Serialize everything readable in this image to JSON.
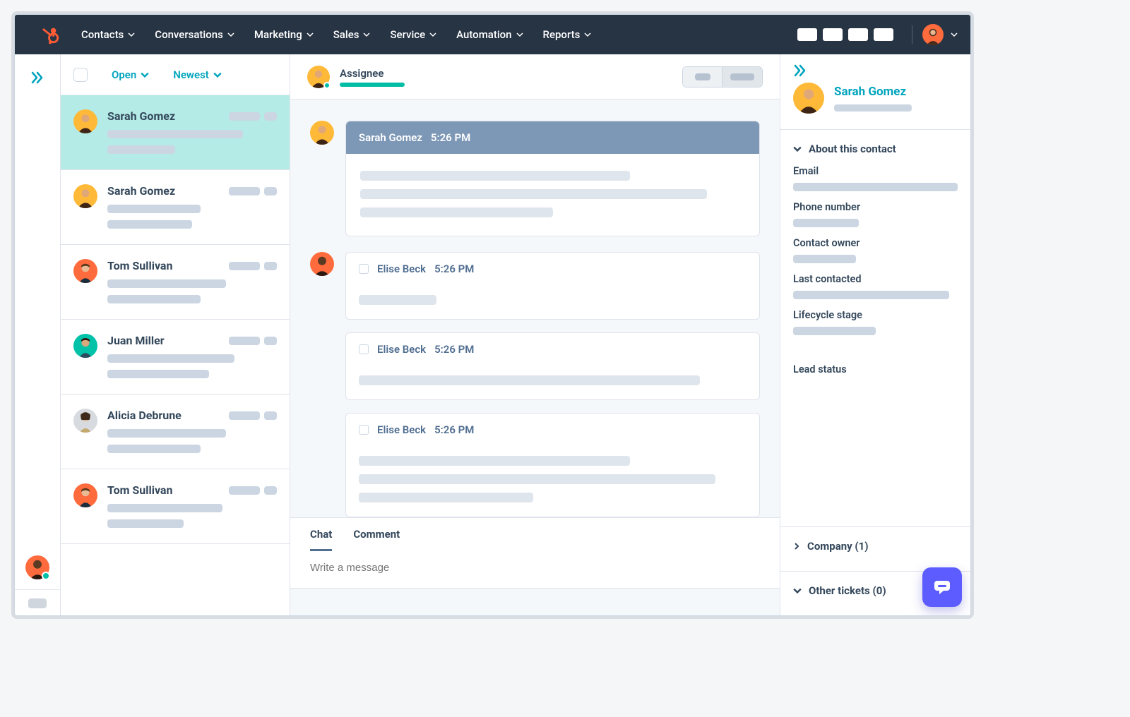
{
  "nav": {
    "items": [
      "Contacts",
      "Conversations",
      "Marketing",
      "Sales",
      "Service",
      "Automation",
      "Reports"
    ]
  },
  "filters": {
    "open": "Open",
    "newest": "Newest"
  },
  "conversations": [
    {
      "name": "Sarah Gomez"
    },
    {
      "name": "Sarah Gomez"
    },
    {
      "name": "Tom Sullivan"
    },
    {
      "name": "Juan Miller"
    },
    {
      "name": "Alicia Debrune"
    },
    {
      "name": "Tom Sullivan"
    }
  ],
  "center": {
    "assignee_label": "Assignee",
    "messages": [
      {
        "sender": "Sarah Gomez",
        "time": "5:26 PM",
        "style": "dark"
      },
      {
        "sender": "Elise Beck",
        "time": "5:26 PM",
        "style": "light"
      },
      {
        "sender": "Elise Beck",
        "time": "5:26 PM",
        "style": "light"
      },
      {
        "sender": "Elise Beck",
        "time": "5:26 PM",
        "style": "light"
      }
    ],
    "tabs": {
      "chat": "Chat",
      "comment": "Comment"
    },
    "placeholder": "Write a message"
  },
  "right": {
    "contact_name": "Sarah Gomez",
    "about_title": "About this contact",
    "fields": {
      "email": "Email",
      "phone": "Phone number",
      "owner": "Contact owner",
      "last_contacted": "Last contacted",
      "lifecycle": "Lifecycle stage",
      "lead_status": "Lead status"
    },
    "company": "Company (1)",
    "tickets": "Other tickets (0)"
  }
}
